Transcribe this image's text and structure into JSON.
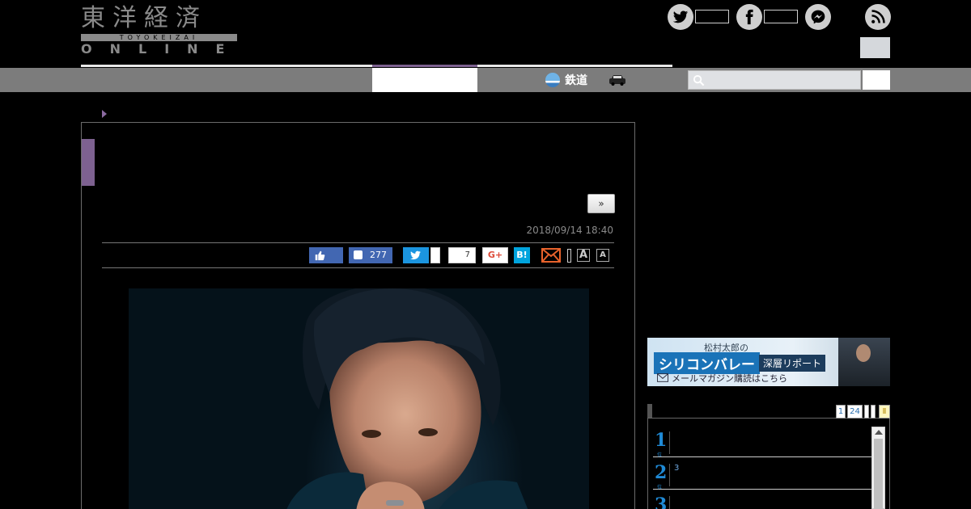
{
  "header": {
    "logo_kanji": "東洋経済",
    "logo_romaji": "TOYOKEIZAI",
    "logo_online": "ONLINE"
  },
  "nav": {
    "rail_label": "鉄道"
  },
  "article": {
    "next_label": "»",
    "date": "2018/09/14 18:40",
    "share": {
      "facebook_count": "277",
      "bubble_count": "7",
      "gplus_label": "G+",
      "hatena_label": "B!",
      "font_large_label": "A",
      "font_small_label": "A"
    }
  },
  "sidebar": {
    "banner": {
      "sub": "松村太郎の",
      "main": "シリコンバレー",
      "tag": "深層リポート",
      "cta": "メールマガジン購読はこちら"
    },
    "ranking": {
      "tabs": [
        "1",
        "24",
        "",
        "",
        "Ⅱ"
      ],
      "rows": [
        {
          "rank": "1",
          "rank_label": "位",
          "text": ""
        },
        {
          "rank": "2",
          "rank_label": "位",
          "text": "3"
        },
        {
          "rank": "3",
          "rank_label": "位",
          "text": ""
        }
      ]
    }
  },
  "colors": {
    "accent_purple": "#7d6190",
    "facebook_blue": "#4267b2",
    "twitter_blue": "#1b95e0",
    "hatena_blue": "#00a4de",
    "rank_blue": "#1f8ad6"
  }
}
